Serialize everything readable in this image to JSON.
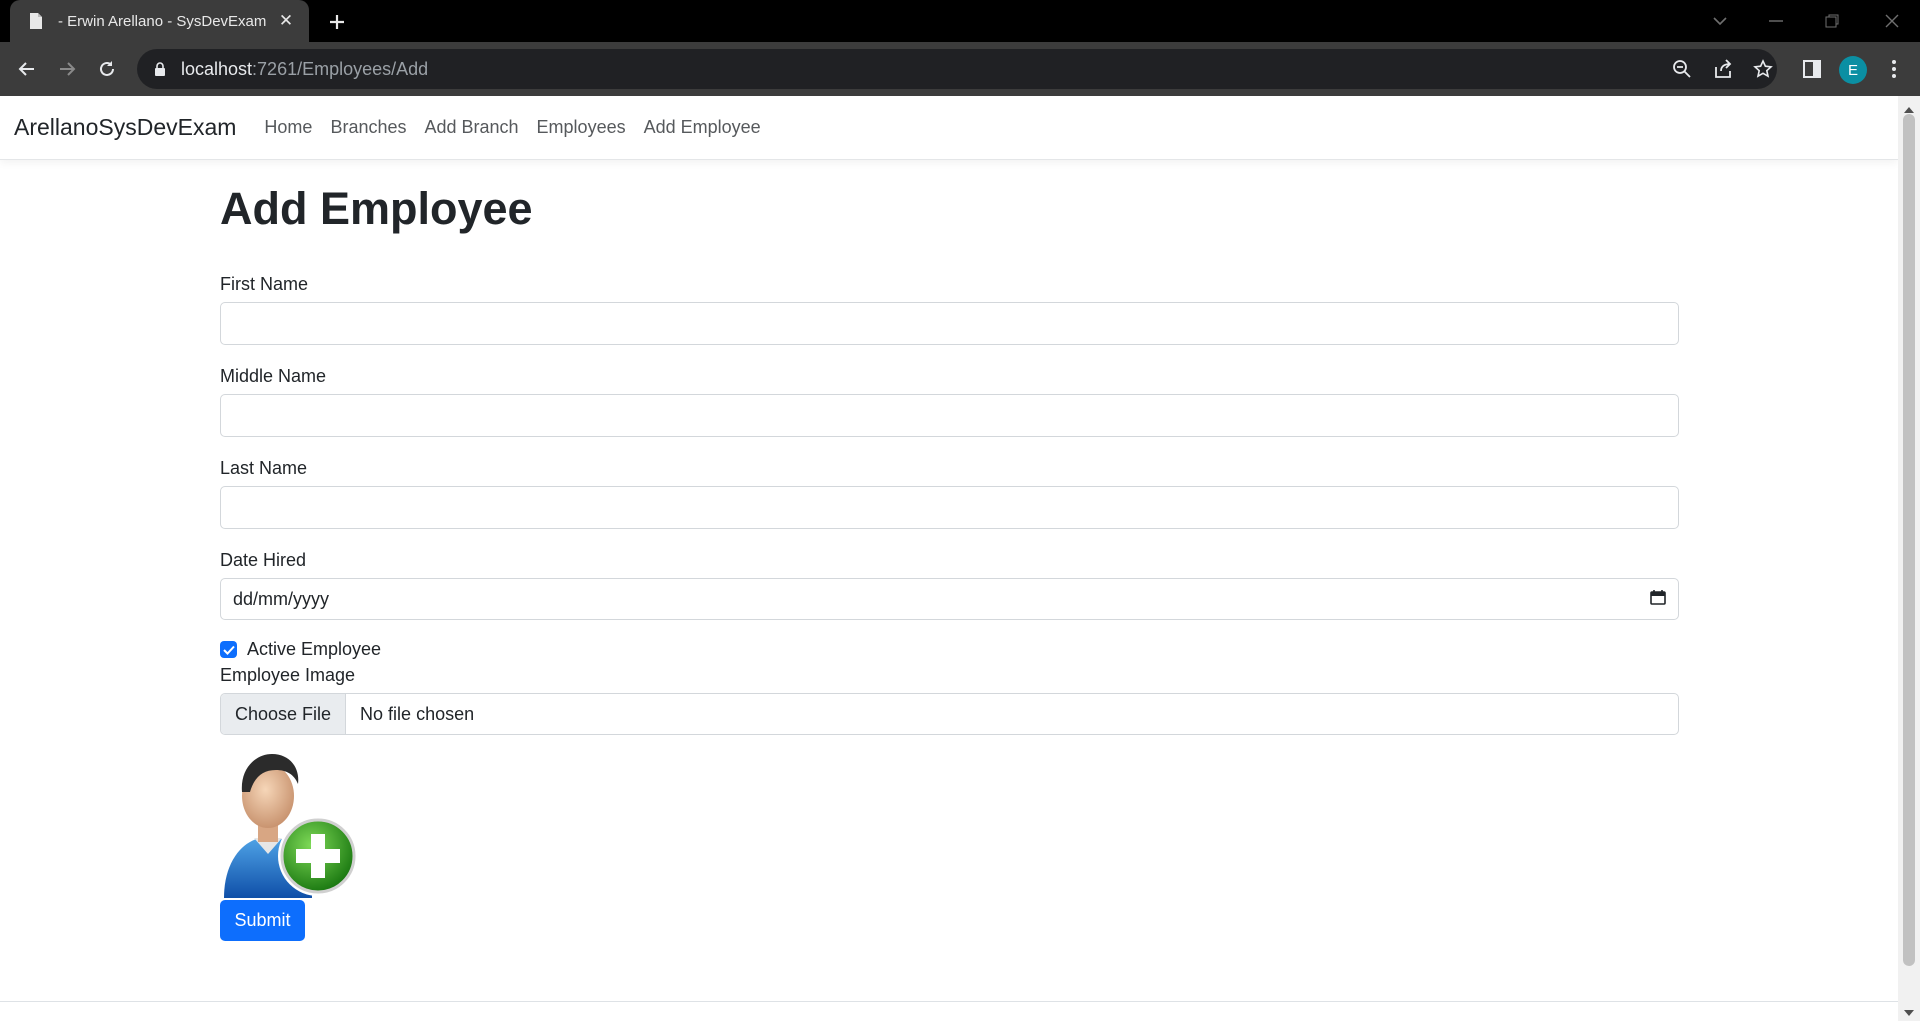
{
  "browser": {
    "tab_title": "- Erwin Arellano - SysDevExam",
    "url_host": "localhost",
    "url_rest": ":7261/Employees/Add",
    "profile_initial": "E"
  },
  "app": {
    "brand": "ArellanoSysDevExam",
    "nav": [
      {
        "label": "Home"
      },
      {
        "label": "Branches"
      },
      {
        "label": "Add Branch"
      },
      {
        "label": "Employees"
      },
      {
        "label": "Add Employee"
      }
    ]
  },
  "form": {
    "title": "Add Employee",
    "first_name_label": "First Name",
    "first_name_value": "",
    "middle_name_label": "Middle Name",
    "middle_name_value": "",
    "last_name_label": "Last Name",
    "last_name_value": "",
    "date_hired_label": "Date Hired",
    "date_hired_placeholder": "dd/mm/yyyy",
    "active_label": "Active Employee",
    "active_checked": true,
    "image_label": "Employee Image",
    "file_button": "Choose File",
    "file_status": "No file chosen",
    "submit_label": "Submit"
  },
  "colors": {
    "primary": "#0d6efd",
    "profile": "#0b8fa3",
    "plus_badge": "#3aa21d"
  }
}
